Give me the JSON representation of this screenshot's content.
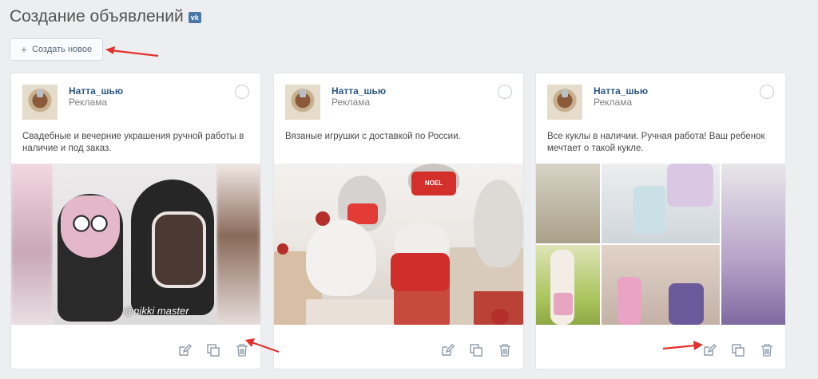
{
  "page": {
    "title": "Создание объявлений",
    "vk_badge": "vk"
  },
  "create_button": {
    "label": "Создать новое",
    "icon": "plus-icon"
  },
  "cards": [
    {
      "author": "Натта_шью",
      "subtitle": "Реклама",
      "description": "Свадебные и вечерние украшения ручной работы в наличие и под заказ.",
      "image": "knitted-mittens",
      "watermark": "@nikki master"
    },
    {
      "author": "Натта_шью",
      "subtitle": "Реклама",
      "description": "Вязаные игрушки с доставкой по России.",
      "image": "knitted-toys",
      "sweater_text": "NOEL"
    },
    {
      "author": "Натта_шью",
      "subtitle": "Реклама",
      "description": "Все куклы в наличии. Ручная работа! Ваш ребенок мечтает о такой кукле.",
      "image": "dolls-collage"
    }
  ],
  "card_actions": [
    "edit-icon",
    "copy-icon",
    "trash-icon"
  ],
  "colors": {
    "background": "#edeef0",
    "link": "#2a5885",
    "vk_blue": "#4a76a8",
    "arrow": "#e3322e"
  }
}
